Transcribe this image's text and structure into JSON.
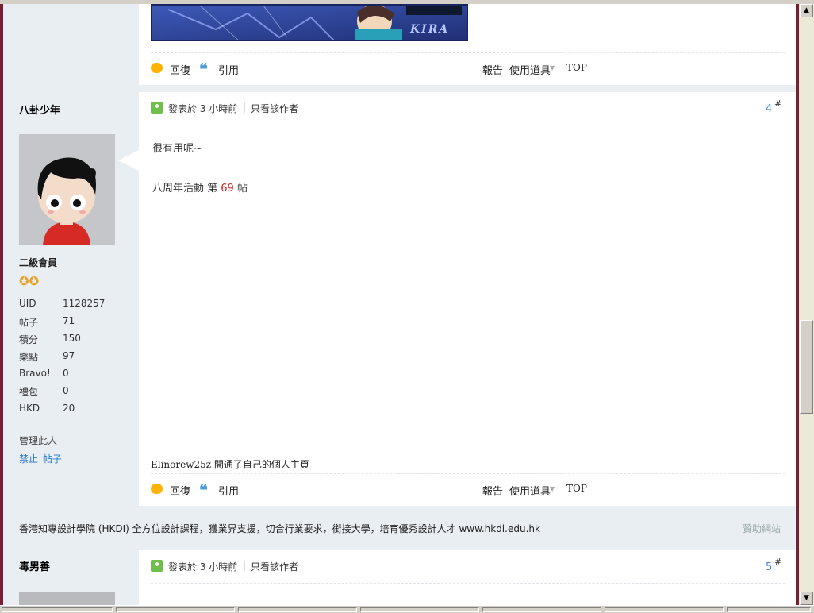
{
  "post3_actions": {
    "reply": "回復",
    "quote": "引用",
    "report": "報告",
    "tools": "使用道具",
    "top": "TOP"
  },
  "post4": {
    "username": "八卦少年",
    "posted": "發表於 3 小時前",
    "pipe": "|",
    "author_only": "只看該作者",
    "floor": "4",
    "floor_mark": "#",
    "content_line1": "很有用呢~",
    "content_line2_prefix": "八周年活動 第",
    "content_line2_number": "69",
    "content_line2_suffix": "帖",
    "activity": "Elinorew25z 開通了自己的個人主頁",
    "rank": "二級會員",
    "stats": [
      {
        "key": "UID",
        "value": "1128257"
      },
      {
        "key": "帖子",
        "value": "71"
      },
      {
        "key": "積分",
        "value": "150"
      },
      {
        "key": "樂點",
        "value": "97"
      },
      {
        "key": "Bravo!",
        "value": "0"
      },
      {
        "key": "禮包",
        "value": "0"
      },
      {
        "key": "HKD",
        "value": "20"
      }
    ],
    "manage": "管理此人",
    "ban": "禁止",
    "posts_link": "帖子",
    "actions": {
      "reply": "回復",
      "quote": "引用",
      "report": "報告",
      "tools": "使用道具",
      "top": "TOP"
    }
  },
  "ad": {
    "text": "香港知專設計學院 (HKDI) 全方位設計課程，獲業界支援，切合行業要求，銜接大學，培育優秀設計人才 www.hkdi.edu.hk",
    "sponsor": "贊助網站"
  },
  "post5": {
    "username": "毒男善",
    "posted": "發表於 3 小時前",
    "pipe": "|",
    "author_only": "只看該作者",
    "floor": "5",
    "floor_mark": "#"
  },
  "banner_caption": "KIRA",
  "colors": {
    "frame_border": "#7a1e35",
    "link_blue": "#3a8acc",
    "number_red": "#d02020",
    "sidebar_bg": "#e9eef3"
  }
}
